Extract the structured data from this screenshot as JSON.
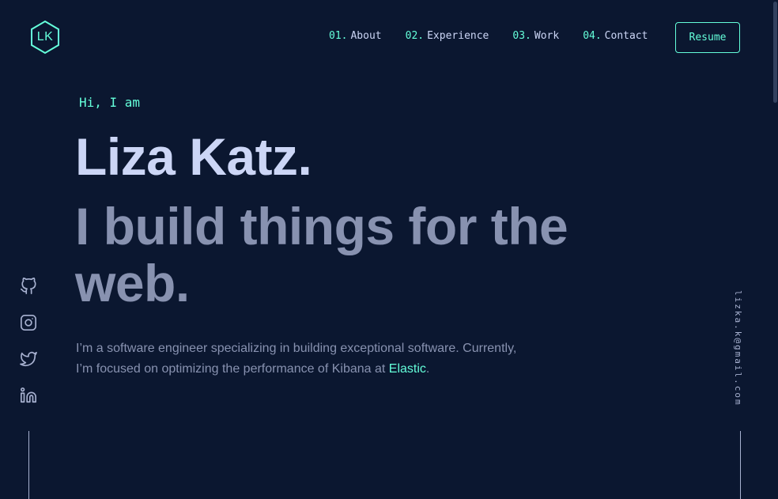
{
  "header": {
    "logo_text": "LK",
    "nav": [
      {
        "num": "01.",
        "label": "About"
      },
      {
        "num": "02.",
        "label": "Experience"
      },
      {
        "num": "03.",
        "label": "Work"
      },
      {
        "num": "04.",
        "label": "Contact"
      }
    ],
    "resume_label": "Resume"
  },
  "hero": {
    "greeting": "Hi, I am",
    "name": "Liza Katz.",
    "tagline": "I build things for the web.",
    "description_part1": "I’m a software engineer specializing in building exceptional software. Currently, I’m focused on optimizing the performance of Kibana at",
    "description_link": "Elastic",
    "description_end": "."
  },
  "socials": [
    {
      "icon": "github-icon"
    },
    {
      "icon": "instagram-icon"
    },
    {
      "icon": "twitter-icon"
    },
    {
      "icon": "linkedin-icon"
    }
  ],
  "email": "lizka.k@gmail.com",
  "colors": {
    "background": "#0b1730",
    "accent": "#64ffda",
    "heading": "#ccd6f6",
    "text": "#8892b0"
  }
}
